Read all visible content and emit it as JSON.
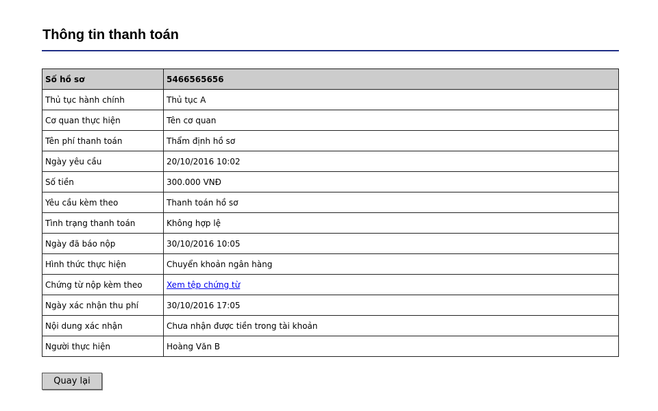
{
  "title": "Thông tin thanh toán",
  "rows": [
    {
      "label": "Số hồ sơ",
      "value": "5466565656"
    },
    {
      "label": "Thủ tục hành chính",
      "value": "Thủ tục A"
    },
    {
      "label": "Cơ quan thực hiện",
      "value": "Tên cơ quan"
    },
    {
      "label": "Tên phí thanh toán",
      "value": "Thẩm định hồ sơ"
    },
    {
      "label": "Ngày yêu cầu",
      "value": "20/10/2016 10:02"
    },
    {
      "label": "Số tiền",
      "value": "300.000 VNĐ"
    },
    {
      "label": "Yêu cầu kèm theo",
      "value": "Thanh toán hồ sơ"
    },
    {
      "label": "Tình trạng thanh toán",
      "value": "Không hợp lệ"
    },
    {
      "label": "Ngày đã báo nộp",
      "value": "30/10/2016 10:05"
    },
    {
      "label": "Hình thức thực hiện",
      "value": "Chuyển khoản ngân hàng"
    },
    {
      "label": "Chứng từ nộp kèm theo",
      "value": "Xem tệp chứng từ"
    },
    {
      "label": "Ngày xác nhận thu phí",
      "value": "30/10/2016 17:05"
    },
    {
      "label": "Nội dung xác nhận",
      "value": "Chưa nhận được tiền trong tài khoản"
    },
    {
      "label": "Người thực hiện",
      "value": "Hoàng Văn B"
    }
  ],
  "back_label": "Quay lại"
}
